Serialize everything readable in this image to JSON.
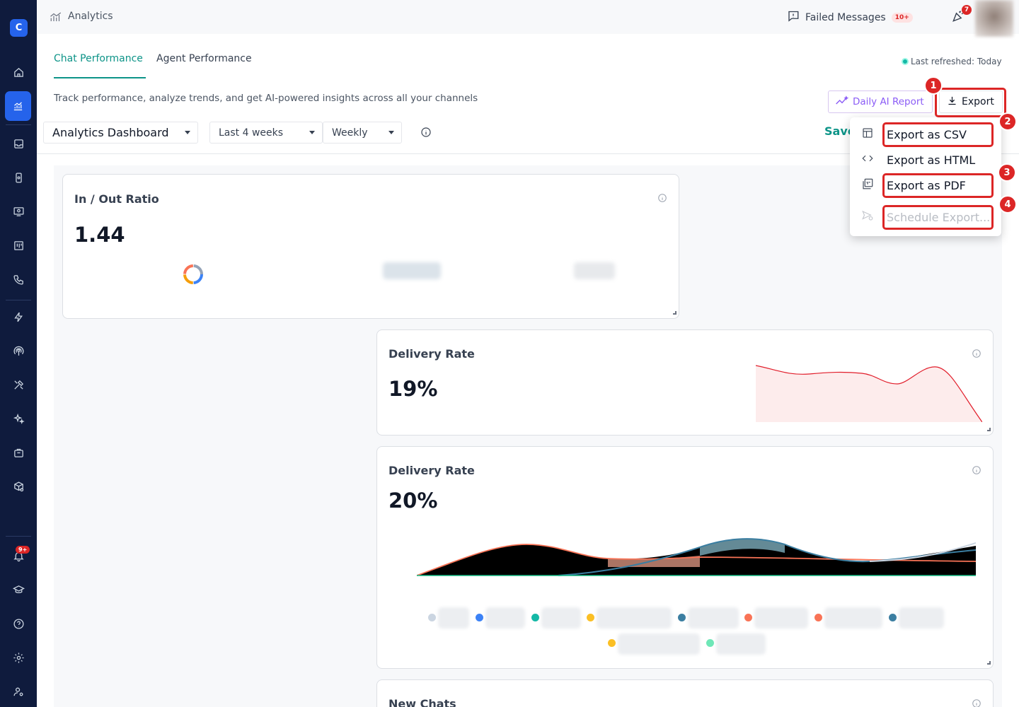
{
  "sidebar": {
    "logo_letter": "C",
    "notification_badge": "9+"
  },
  "topbar": {
    "title": "Analytics",
    "failed_messages_label": "Failed Messages",
    "failed_messages_badge": "10+",
    "party_badge": "7"
  },
  "tabs": [
    {
      "label": "Chat Performance",
      "active": true
    },
    {
      "label": "Agent Performance",
      "active": false
    }
  ],
  "last_refreshed": "Last refreshed: Today",
  "subtitle": "Track performance, analyze trends, and get AI-powered insights across all your channels",
  "buttons": {
    "daily_ai_report": "Daily AI Report",
    "export": "Export",
    "save": "Save"
  },
  "controls": {
    "dashboard_select": "Analytics Dashboard",
    "range_select": "Last 4 weeks",
    "granularity_select": "Weekly"
  },
  "export_menu": {
    "items": [
      {
        "label": "Export as CSV",
        "icon": "table-icon",
        "disabled": false
      },
      {
        "label": "Export as HTML",
        "icon": "code-icon",
        "disabled": false
      },
      {
        "label": "Export as PDF",
        "icon": "pdf-icon",
        "disabled": false
      },
      {
        "label": "Schedule Export...",
        "icon": "send-clock-icon",
        "disabled": true
      }
    ]
  },
  "annotations": [
    "1",
    "2",
    "3",
    "4"
  ],
  "cards": {
    "in_out": {
      "title": "In / Out Ratio",
      "value": "1.44"
    },
    "delivery_1": {
      "title": "Delivery Rate",
      "value": "19%"
    },
    "delivery_2": {
      "title": "Delivery Rate",
      "value": "20%"
    },
    "new_chats": {
      "title": "New Chats"
    }
  },
  "colors": {
    "accent": "#0d9488",
    "sidebar": "#0f1b3d",
    "highlight": "#dc2626",
    "ai_purple": "#8b5cf6",
    "legend": [
      "#cbd5e1",
      "#3b82f6",
      "#14b8a6",
      "#fbbf24",
      "#3b7ea1",
      "#f97356",
      "#f97356",
      "#3b7ea1",
      "#fbbf24",
      "#6ee7b7"
    ]
  }
}
